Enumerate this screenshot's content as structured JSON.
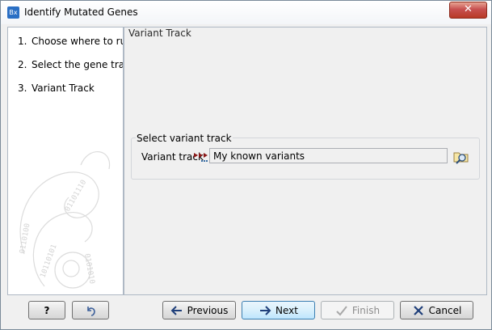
{
  "window": {
    "title": "Identify Mutated Genes",
    "app_icon_text": "Bx"
  },
  "steps": [
    {
      "num": "1.",
      "label": "Choose where to run"
    },
    {
      "num": "2.",
      "label": "Select the gene track"
    },
    {
      "num": "3.",
      "label": "Variant Track"
    }
  ],
  "panel": {
    "title": "Variant Track",
    "group_title": "Select variant track",
    "field_label": "Variant track",
    "field_value": "My known variants"
  },
  "buttons": {
    "help": "?",
    "previous": "Previous",
    "next": "Next",
    "finish": "Finish",
    "cancel": "Cancel"
  },
  "colors": {
    "accent": "#2a6fc4",
    "close": "#c75050",
    "track_icon": "#8b1a1a"
  }
}
